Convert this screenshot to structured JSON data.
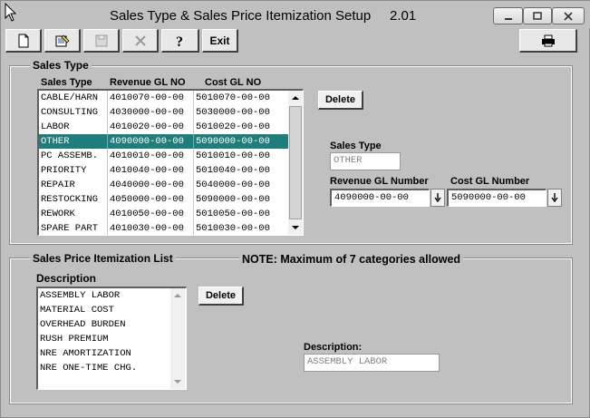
{
  "window": {
    "title": "Sales Type & Sales Price Itemization Setup     2.01"
  },
  "toolbar": {
    "new_icon": "new-document-icon",
    "edit_icon": "edit-icon",
    "save_icon": "save-icon",
    "delete_icon": "delete-x-icon",
    "help_icon": "help-question-icon",
    "exit_label": "Exit",
    "print_icon": "printer-icon"
  },
  "sales_type": {
    "group_title": "Sales Type",
    "headers": [
      "Sales Type",
      "Revenue GL NO",
      "Cost GL NO"
    ],
    "rows": [
      [
        "CABLE/HARN",
        "4010070-00-00",
        "5010070-00-00"
      ],
      [
        "CONSULTING",
        "4030000-00-00",
        "5030000-00-00"
      ],
      [
        "LABOR",
        "4010020-00-00",
        "5010020-00-00"
      ],
      [
        "OTHER",
        "4090000-00-00",
        "5090000-00-00"
      ],
      [
        "PC ASSEMB.",
        "4010010-00-00",
        "5010010-00-00"
      ],
      [
        "PRIORITY",
        "4010040-00-00",
        "5010040-00-00"
      ],
      [
        "REPAIR",
        "4040000-00-00",
        "5040000-00-00"
      ],
      [
        "RESTOCKING",
        "4050000-00-00",
        "5090000-00-00"
      ],
      [
        "REWORK",
        "4010050-00-00",
        "5010050-00-00"
      ],
      [
        "SPARE PART",
        "4010030-00-00",
        "5010030-00-00"
      ]
    ],
    "selected_index": 3,
    "delete_label": "Delete",
    "sales_type_label": "Sales Type",
    "sales_type_value": "OTHER",
    "revenue_label": "Revenue GL Number",
    "revenue_value": "4090000-00-00",
    "cost_label": "Cost GL Number",
    "cost_value": "5090000-00-00"
  },
  "itemization": {
    "group_title": "Sales Price Itemization List",
    "note": "NOTE: Maximum of 7 categories allowed",
    "description_header": "Description",
    "items": [
      "ASSEMBLY LABOR",
      "MATERIAL COST",
      "OVERHEAD BURDEN",
      "RUSH PREMIUM",
      "NRE AMORTIZATION",
      "NRE ONE-TIME CHG."
    ],
    "delete_label": "Delete",
    "description_label": "Description:",
    "description_value": "ASSEMBLY LABOR"
  },
  "colors": {
    "selection": "#1e7d7d",
    "face": "#c0c0c0"
  }
}
